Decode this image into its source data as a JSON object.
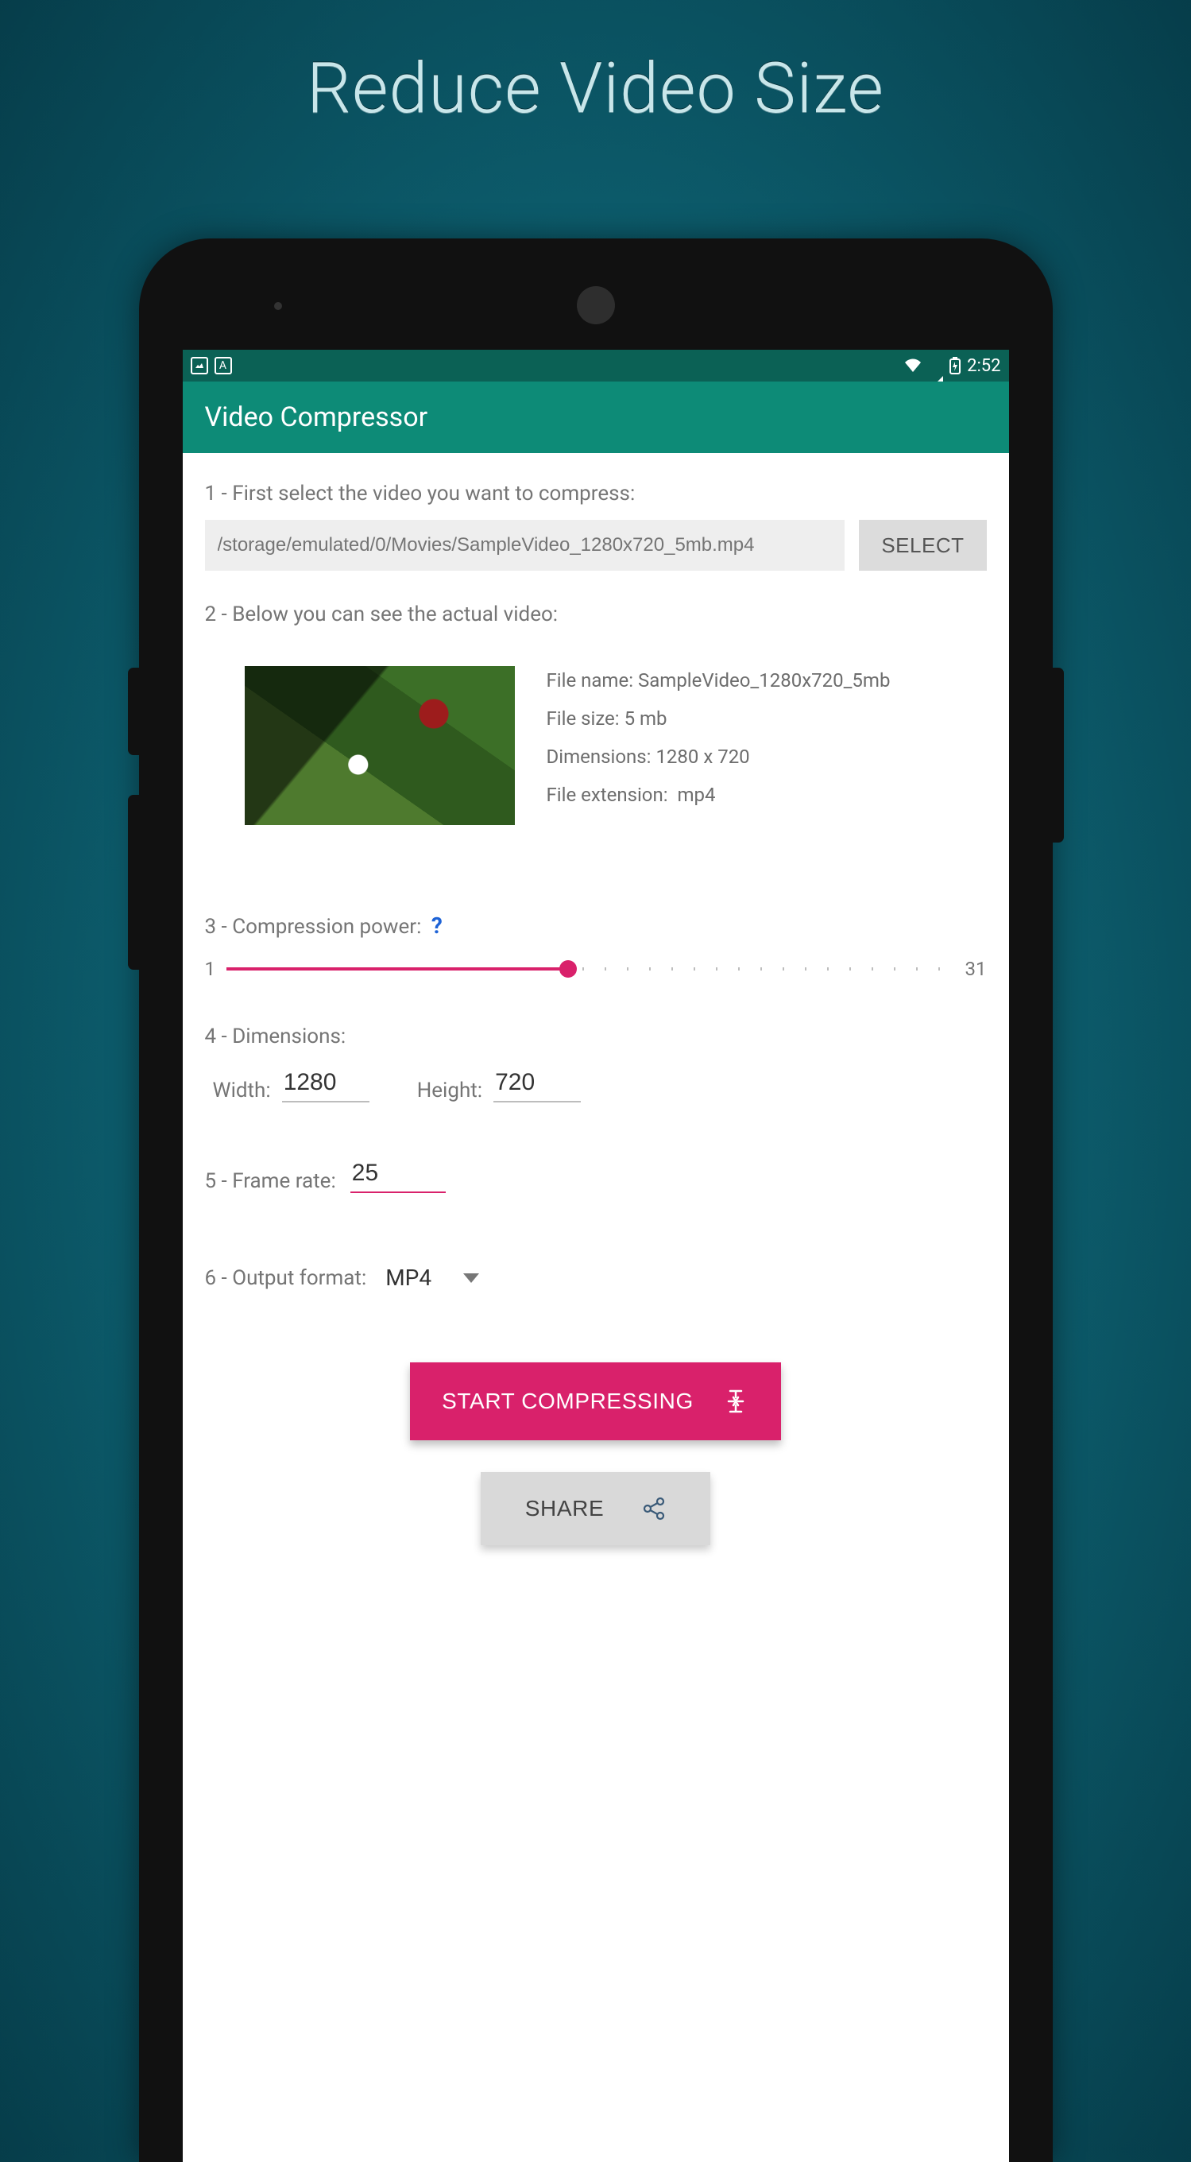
{
  "promo_title": "Reduce Video Size",
  "status": {
    "time": "2:52"
  },
  "app_bar": {
    "title": "Video Compressor"
  },
  "steps": {
    "s1_label": "1 - First select the video you want to compress:",
    "s1_path": "/storage/emulated/0/Movies/SampleVideo_1280x720_5mb.mp4",
    "s1_select": "SELECT",
    "s2_label": "2 - Below you can see the actual video:",
    "s2_meta": {
      "filename_label": "File name:",
      "filename": "SampleVideo_1280x720_5mb",
      "filesize_label": "File size:",
      "filesize": "5 mb",
      "dimensions_label": "Dimensions:",
      "dimensions": "1280 x 720",
      "extension_label": "File extension:",
      "extension": "mp4"
    },
    "s3_label": "3 - Compression power:",
    "s3_help": "?",
    "slider": {
      "min": "1",
      "max": "31",
      "value": 15,
      "percent": 47
    },
    "s4_label": "4 - Dimensions:",
    "s4_width_label": "Width:",
    "s4_width": "1280",
    "s4_height_label": "Height:",
    "s4_height": "720",
    "s5_label": "5 - Frame rate:",
    "s5_value": "25",
    "s6_label": "6 - Output format:",
    "s6_value": "MP4"
  },
  "actions": {
    "start": "START COMPRESSING",
    "share": "SHARE"
  }
}
